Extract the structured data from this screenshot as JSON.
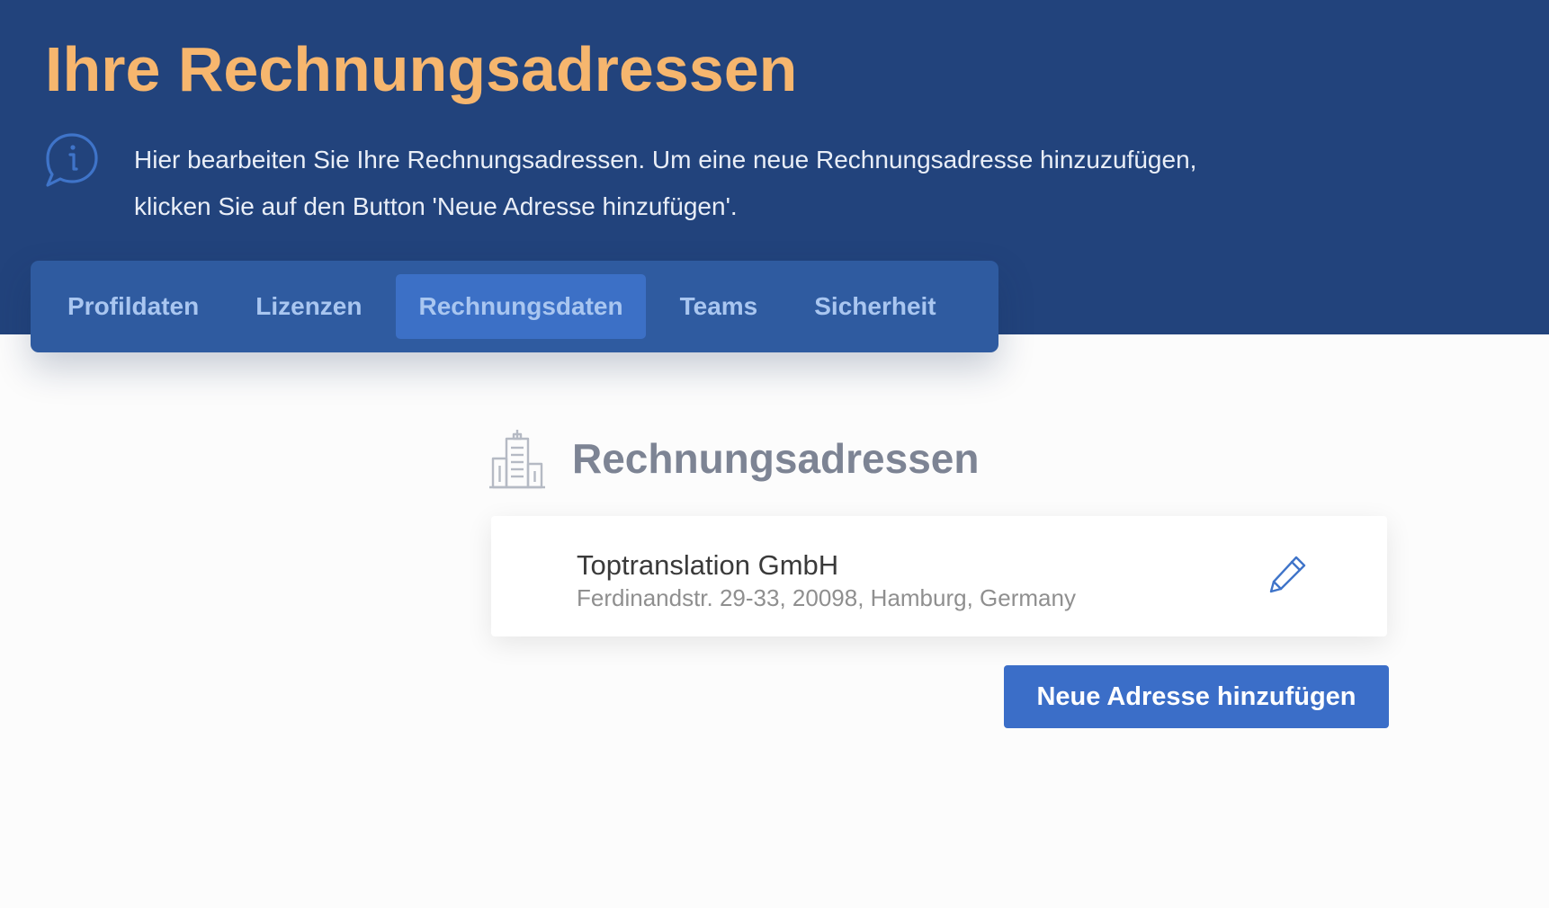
{
  "header": {
    "title": "Ihre Rechnungsadressen",
    "info_text": "Hier bearbeiten Sie Ihre Rechnungsadressen. Um eine neue Rechnungsadresse hinzuzufügen, klicken Sie auf den Button 'Neue Adresse hinzufügen'."
  },
  "tabs": [
    {
      "label": "Profildaten",
      "active": false
    },
    {
      "label": "Lizenzen",
      "active": false
    },
    {
      "label": "Rechnungsdaten",
      "active": true
    },
    {
      "label": "Teams",
      "active": false
    },
    {
      "label": "Sicherheit",
      "active": false
    }
  ],
  "section": {
    "title": "Rechnungsadressen",
    "icon": "building-icon"
  },
  "addresses": [
    {
      "name": "Toptranslation GmbH",
      "address": "Ferdinandstr. 29-33, 20098, Hamburg, Germany"
    }
  ],
  "actions": {
    "add_address_label": "Neue Adresse hinzufügen"
  },
  "colors": {
    "header_bg": "#22437c",
    "title": "#f6b66e",
    "tab_bar": "#2f5ba0",
    "tab_active": "#3c70c6",
    "primary_button": "#3b6ec8"
  }
}
